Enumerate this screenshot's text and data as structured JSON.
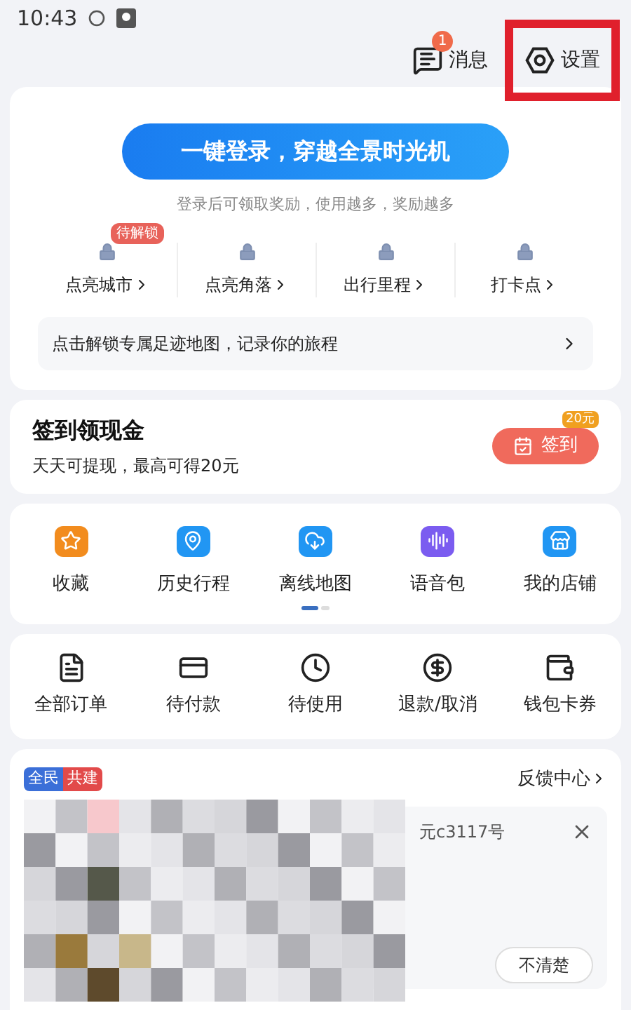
{
  "status_bar": {
    "time": "10:43"
  },
  "top_bar": {
    "messages": {
      "label": "消息",
      "badge": "1"
    },
    "settings": {
      "label": "设置",
      "highlighted": true
    }
  },
  "login_card": {
    "button": "一键登录，穿越全景时光机",
    "hint": "登录后可领取奖励，使用越多，奖励越多",
    "stats": [
      {
        "label": "点亮城市",
        "badge": "待解锁",
        "locked": true
      },
      {
        "label": "点亮角落",
        "locked": true
      },
      {
        "label": "出行里程",
        "locked": true
      },
      {
        "label": "打卡点",
        "locked": true
      }
    ],
    "map_banner": "点击解锁专属足迹地图，记录你的旅程"
  },
  "checkin_card": {
    "title": "签到领现金",
    "subtitle": "天天可提现，最高可得20元",
    "button": "签到",
    "button_badge": "20元"
  },
  "tools": [
    {
      "label": "收藏",
      "kind": "star"
    },
    {
      "label": "历史行程",
      "kind": "history"
    },
    {
      "label": "离线地图",
      "kind": "cloud"
    },
    {
      "label": "语音包",
      "kind": "voice"
    },
    {
      "label": "我的店铺",
      "kind": "shop"
    }
  ],
  "tools_pager": [
    {
      "selected": true
    },
    {
      "selected": false
    }
  ],
  "orders": [
    {
      "label": "全部订单",
      "kind": "list"
    },
    {
      "label": "待付款",
      "kind": "card"
    },
    {
      "label": "待使用",
      "kind": "clock"
    },
    {
      "label": "退款/取消",
      "kind": "refund"
    },
    {
      "label": "钱包卡券",
      "kind": "wallet"
    }
  ],
  "feedback_card": {
    "tag_left": "全民",
    "tag_right": "共建",
    "link": "反馈中心",
    "question_tail": "元c3117号",
    "answer": "不清楚"
  }
}
